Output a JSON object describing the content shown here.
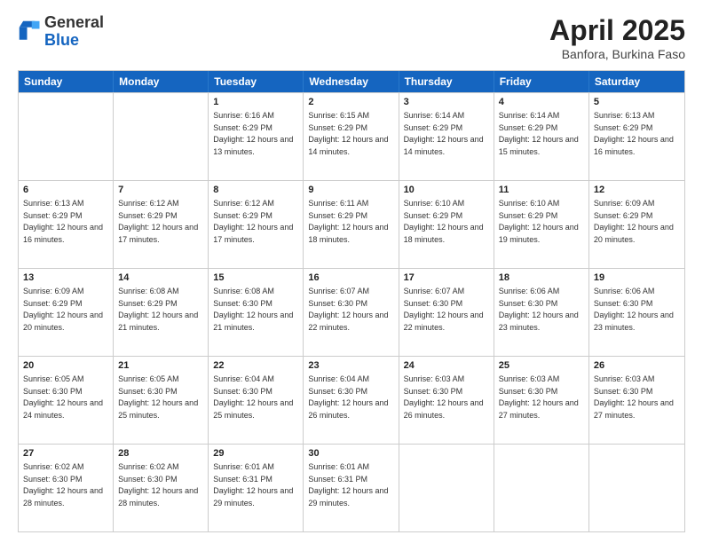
{
  "header": {
    "logo_general": "General",
    "logo_blue": "Blue",
    "title": "April 2025",
    "location": "Banfora, Burkina Faso"
  },
  "weekdays": [
    "Sunday",
    "Monday",
    "Tuesday",
    "Wednesday",
    "Thursday",
    "Friday",
    "Saturday"
  ],
  "weeks": [
    [
      {
        "day": "",
        "sunrise": "",
        "sunset": "",
        "daylight": ""
      },
      {
        "day": "",
        "sunrise": "",
        "sunset": "",
        "daylight": ""
      },
      {
        "day": "1",
        "sunrise": "Sunrise: 6:16 AM",
        "sunset": "Sunset: 6:29 PM",
        "daylight": "Daylight: 12 hours and 13 minutes."
      },
      {
        "day": "2",
        "sunrise": "Sunrise: 6:15 AM",
        "sunset": "Sunset: 6:29 PM",
        "daylight": "Daylight: 12 hours and 14 minutes."
      },
      {
        "day": "3",
        "sunrise": "Sunrise: 6:14 AM",
        "sunset": "Sunset: 6:29 PM",
        "daylight": "Daylight: 12 hours and 14 minutes."
      },
      {
        "day": "4",
        "sunrise": "Sunrise: 6:14 AM",
        "sunset": "Sunset: 6:29 PM",
        "daylight": "Daylight: 12 hours and 15 minutes."
      },
      {
        "day": "5",
        "sunrise": "Sunrise: 6:13 AM",
        "sunset": "Sunset: 6:29 PM",
        "daylight": "Daylight: 12 hours and 16 minutes."
      }
    ],
    [
      {
        "day": "6",
        "sunrise": "Sunrise: 6:13 AM",
        "sunset": "Sunset: 6:29 PM",
        "daylight": "Daylight: 12 hours and 16 minutes."
      },
      {
        "day": "7",
        "sunrise": "Sunrise: 6:12 AM",
        "sunset": "Sunset: 6:29 PM",
        "daylight": "Daylight: 12 hours and 17 minutes."
      },
      {
        "day": "8",
        "sunrise": "Sunrise: 6:12 AM",
        "sunset": "Sunset: 6:29 PM",
        "daylight": "Daylight: 12 hours and 17 minutes."
      },
      {
        "day": "9",
        "sunrise": "Sunrise: 6:11 AM",
        "sunset": "Sunset: 6:29 PM",
        "daylight": "Daylight: 12 hours and 18 minutes."
      },
      {
        "day": "10",
        "sunrise": "Sunrise: 6:10 AM",
        "sunset": "Sunset: 6:29 PM",
        "daylight": "Daylight: 12 hours and 18 minutes."
      },
      {
        "day": "11",
        "sunrise": "Sunrise: 6:10 AM",
        "sunset": "Sunset: 6:29 PM",
        "daylight": "Daylight: 12 hours and 19 minutes."
      },
      {
        "day": "12",
        "sunrise": "Sunrise: 6:09 AM",
        "sunset": "Sunset: 6:29 PM",
        "daylight": "Daylight: 12 hours and 20 minutes."
      }
    ],
    [
      {
        "day": "13",
        "sunrise": "Sunrise: 6:09 AM",
        "sunset": "Sunset: 6:29 PM",
        "daylight": "Daylight: 12 hours and 20 minutes."
      },
      {
        "day": "14",
        "sunrise": "Sunrise: 6:08 AM",
        "sunset": "Sunset: 6:29 PM",
        "daylight": "Daylight: 12 hours and 21 minutes."
      },
      {
        "day": "15",
        "sunrise": "Sunrise: 6:08 AM",
        "sunset": "Sunset: 6:30 PM",
        "daylight": "Daylight: 12 hours and 21 minutes."
      },
      {
        "day": "16",
        "sunrise": "Sunrise: 6:07 AM",
        "sunset": "Sunset: 6:30 PM",
        "daylight": "Daylight: 12 hours and 22 minutes."
      },
      {
        "day": "17",
        "sunrise": "Sunrise: 6:07 AM",
        "sunset": "Sunset: 6:30 PM",
        "daylight": "Daylight: 12 hours and 22 minutes."
      },
      {
        "day": "18",
        "sunrise": "Sunrise: 6:06 AM",
        "sunset": "Sunset: 6:30 PM",
        "daylight": "Daylight: 12 hours and 23 minutes."
      },
      {
        "day": "19",
        "sunrise": "Sunrise: 6:06 AM",
        "sunset": "Sunset: 6:30 PM",
        "daylight": "Daylight: 12 hours and 23 minutes."
      }
    ],
    [
      {
        "day": "20",
        "sunrise": "Sunrise: 6:05 AM",
        "sunset": "Sunset: 6:30 PM",
        "daylight": "Daylight: 12 hours and 24 minutes."
      },
      {
        "day": "21",
        "sunrise": "Sunrise: 6:05 AM",
        "sunset": "Sunset: 6:30 PM",
        "daylight": "Daylight: 12 hours and 25 minutes."
      },
      {
        "day": "22",
        "sunrise": "Sunrise: 6:04 AM",
        "sunset": "Sunset: 6:30 PM",
        "daylight": "Daylight: 12 hours and 25 minutes."
      },
      {
        "day": "23",
        "sunrise": "Sunrise: 6:04 AM",
        "sunset": "Sunset: 6:30 PM",
        "daylight": "Daylight: 12 hours and 26 minutes."
      },
      {
        "day": "24",
        "sunrise": "Sunrise: 6:03 AM",
        "sunset": "Sunset: 6:30 PM",
        "daylight": "Daylight: 12 hours and 26 minutes."
      },
      {
        "day": "25",
        "sunrise": "Sunrise: 6:03 AM",
        "sunset": "Sunset: 6:30 PM",
        "daylight": "Daylight: 12 hours and 27 minutes."
      },
      {
        "day": "26",
        "sunrise": "Sunrise: 6:03 AM",
        "sunset": "Sunset: 6:30 PM",
        "daylight": "Daylight: 12 hours and 27 minutes."
      }
    ],
    [
      {
        "day": "27",
        "sunrise": "Sunrise: 6:02 AM",
        "sunset": "Sunset: 6:30 PM",
        "daylight": "Daylight: 12 hours and 28 minutes."
      },
      {
        "day": "28",
        "sunrise": "Sunrise: 6:02 AM",
        "sunset": "Sunset: 6:30 PM",
        "daylight": "Daylight: 12 hours and 28 minutes."
      },
      {
        "day": "29",
        "sunrise": "Sunrise: 6:01 AM",
        "sunset": "Sunset: 6:31 PM",
        "daylight": "Daylight: 12 hours and 29 minutes."
      },
      {
        "day": "30",
        "sunrise": "Sunrise: 6:01 AM",
        "sunset": "Sunset: 6:31 PM",
        "daylight": "Daylight: 12 hours and 29 minutes."
      },
      {
        "day": "",
        "sunrise": "",
        "sunset": "",
        "daylight": ""
      },
      {
        "day": "",
        "sunrise": "",
        "sunset": "",
        "daylight": ""
      },
      {
        "day": "",
        "sunrise": "",
        "sunset": "",
        "daylight": ""
      }
    ]
  ]
}
